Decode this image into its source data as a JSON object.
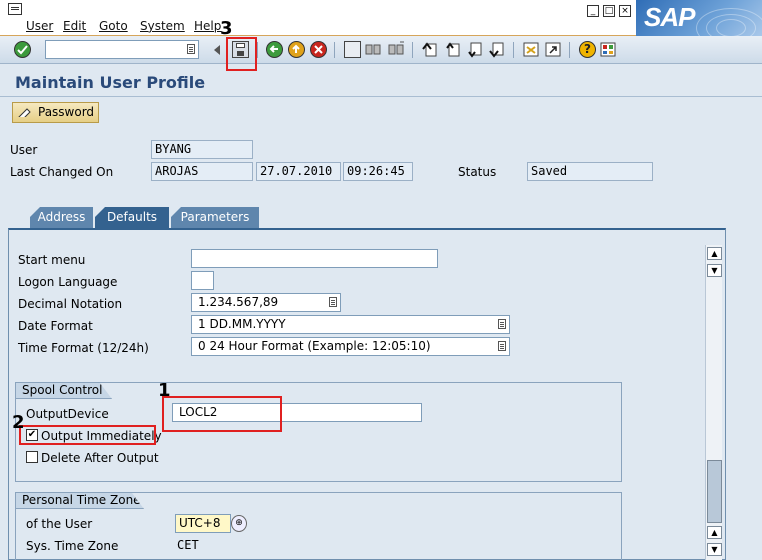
{
  "menu": [
    "User",
    "Edit",
    "Goto",
    "System",
    "Help"
  ],
  "logo_text": "SAP",
  "window_controls": [
    "minimize-icon",
    "restore-icon",
    "close-icon"
  ],
  "toolbar": {
    "command_field_value": "",
    "icons": [
      "enter-icon",
      "save-icon",
      "back-icon",
      "exit-icon",
      "cancel-icon",
      "print-icon",
      "find-icon",
      "find-next-icon",
      "first-page-icon",
      "previous-page-icon",
      "next-page-icon",
      "last-page-icon",
      "new-session-icon",
      "shortcut-icon",
      "help-icon",
      "customize-layout-icon"
    ]
  },
  "page_title": "Maintain User Profile",
  "password_button": "Password",
  "header": {
    "user_label": "User",
    "user_value": "BYANG",
    "last_changed_label": "Last Changed On",
    "last_changed_by": "AROJAS",
    "last_changed_date": "27.07.2010",
    "last_changed_time": "09:26:45",
    "status_label": "Status",
    "status_value": "Saved"
  },
  "tabs": [
    {
      "label": "Address",
      "active": false
    },
    {
      "label": "Defaults",
      "active": true
    },
    {
      "label": "Parameters",
      "active": false
    }
  ],
  "defaults": {
    "start_menu_label": "Start menu",
    "start_menu_value": "",
    "logon_language_label": "Logon Language",
    "logon_language_value": "",
    "decimal_notation_label": "Decimal Notation",
    "decimal_notation_value": "1.234.567,89",
    "date_format_label": "Date Format",
    "date_format_value": "1 DD.MM.YYYY",
    "time_format_label": "Time Format (12/24h)",
    "time_format_value": "0 24 Hour Format (Example: 12:05:10)"
  },
  "spool": {
    "title": "Spool Control",
    "output_device_label": "OutputDevice",
    "output_device_value": "LOCL2",
    "output_immediately_label": "Output Immediately",
    "output_immediately_checked": true,
    "delete_after_output_label": "Delete After Output",
    "delete_after_output_checked": false
  },
  "timezone": {
    "title": "Personal Time Zone",
    "of_user_label": "of the User",
    "of_user_value": "UTC+8",
    "sys_tz_label": "Sys. Time Zone",
    "sys_tz_value": "CET"
  },
  "annotations": [
    "1",
    "2",
    "3"
  ],
  "colors": {
    "highlight": "#e02020",
    "title": "#2a4a7a",
    "tab_active": "#34628f"
  }
}
